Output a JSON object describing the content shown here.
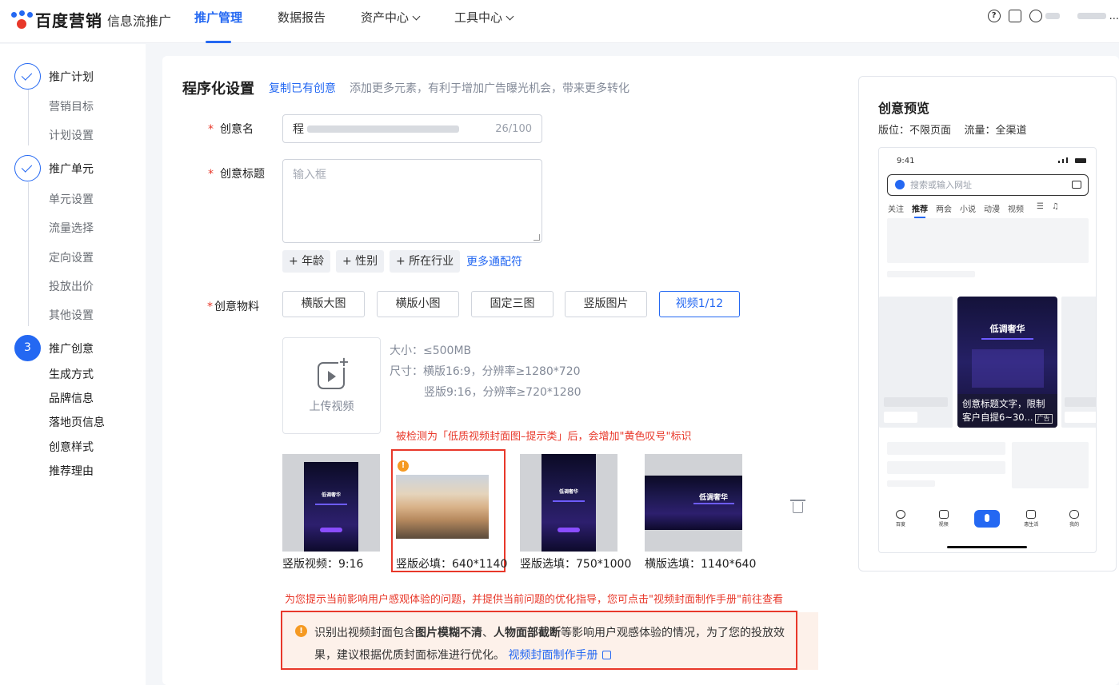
{
  "brand": {
    "name": "百度营销",
    "product": "信息流推广"
  },
  "nav": [
    {
      "label": "推广管理",
      "active": true
    },
    {
      "label": "数据报告"
    },
    {
      "label": "资产中心"
    },
    {
      "label": "工具中心"
    }
  ],
  "top_right": {
    "help_icon": "?",
    "more": "..."
  },
  "steps": {
    "plan": {
      "label": "推广计划",
      "subs": [
        "营销目标",
        "计划设置"
      ]
    },
    "unit": {
      "label": "推广单元",
      "subs": [
        "单元设置",
        "流量选择",
        "定向设置",
        "投放出价",
        "其他设置"
      ]
    },
    "creative": {
      "number": "3",
      "label": "推广创意",
      "subs": [
        "生成方式",
        "品牌信息",
        "落地页信息",
        "创意样式",
        "推荐理由"
      ]
    }
  },
  "section": {
    "title": "程序化设置",
    "copy_link": "复制已有创意",
    "desc": "添加更多元素，有利于增加广告曝光机会，带来更多转化"
  },
  "form": {
    "name_label": "创意名",
    "name_prefix": "程",
    "name_count": "26/100",
    "title_label": "创意标题",
    "title_placeholder": "输入框",
    "wildcards": [
      "+ 年龄",
      "+ 性别",
      "+ 所在行业"
    ],
    "more_wildcards": "更多通配符",
    "material_label": "创意物料",
    "material_tabs": [
      "横版大图",
      "横版小图",
      "固定三图",
      "竖版图片",
      "视频1/12"
    ]
  },
  "upload": {
    "label": "上传视频",
    "spec_size": "大小：≤500MB",
    "spec_dim1": "尺寸：横版16:9，分辨率≥1280*720",
    "spec_dim2": "竖版9:16，分辨率≥720*1280"
  },
  "notes": {
    "detect": "被检测为「低质视频封面图–提示类」后，会增加\"黄色叹号\"标识",
    "hint": "为您提示当前影响用户感观体验的问题，并提供当前问题的优化指导，您可点击\"视频封面制作手册\"前往查看"
  },
  "thumbs": [
    {
      "caption": "竖版视频：9:16",
      "poster": "低调奢华"
    },
    {
      "caption": "竖版必填：640*1140",
      "warn": "!"
    },
    {
      "caption": "竖版选填：750*1000",
      "poster": "低调奢华"
    },
    {
      "caption": "横版选填：1140*640",
      "poster": "低调奢华"
    }
  ],
  "alert": {
    "icon": "!",
    "t1": "识别出视频封面包含",
    "b1": "图片模糊不清",
    "sep": "、",
    "b2": "人物面部截断",
    "t2": "等影响用户观感体验的情况，为了您的投放效",
    "t3": "果，建议根据优质封面标准进行优化。",
    "link": "视频封面制作手册"
  },
  "preview": {
    "title": "创意预览",
    "placement": "版位：不限页面",
    "traffic": "流量：全渠道",
    "time": "9:41",
    "search_placeholder": "搜索或输入网址",
    "tabs": [
      "关注",
      "推荐",
      "两会",
      "小说",
      "动漫",
      "视频",
      "☰",
      "♫"
    ],
    "ad_caption": "创意标题文字，限制客户自提6~30...",
    "ad_tag": "广告",
    "ad_poster": "低调奢华",
    "bottom_nav": [
      "百度",
      "视频",
      "",
      "惠生活",
      "我的"
    ]
  },
  "colors": {
    "accent": "#2468f2",
    "danger": "#e8382a",
    "warning": "#f59a23"
  }
}
